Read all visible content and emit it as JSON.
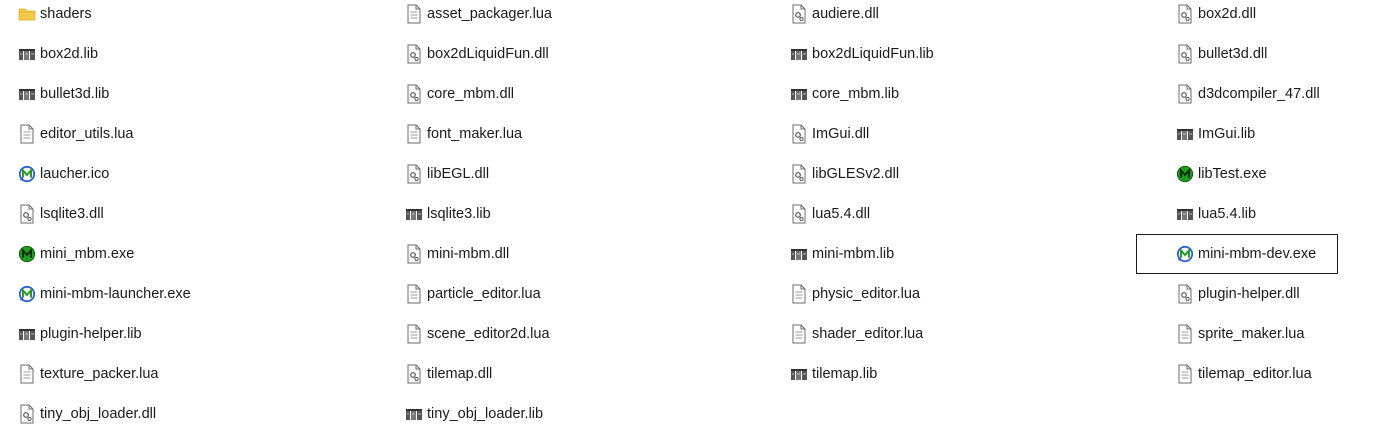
{
  "files": [
    {
      "name": "shaders",
      "icon": "folder-icon"
    },
    {
      "name": "asset_packager.lua",
      "icon": "text-file-icon"
    },
    {
      "name": "audiere.dll",
      "icon": "dll-file-icon"
    },
    {
      "name": "box2d.dll",
      "icon": "dll-file-icon"
    },
    {
      "name": "box2d.lib",
      "icon": "lib-file-icon"
    },
    {
      "name": "box2dLiquidFun.dll",
      "icon": "dll-file-icon"
    },
    {
      "name": "box2dLiquidFun.lib",
      "icon": "lib-file-icon"
    },
    {
      "name": "bullet3d.dll",
      "icon": "dll-file-icon"
    },
    {
      "name": "bullet3d.lib",
      "icon": "lib-file-icon"
    },
    {
      "name": "core_mbm.dll",
      "icon": "dll-file-icon"
    },
    {
      "name": "core_mbm.lib",
      "icon": "lib-file-icon"
    },
    {
      "name": "d3dcompiler_47.dll",
      "icon": "dll-file-icon"
    },
    {
      "name": "editor_utils.lua",
      "icon": "text-file-icon"
    },
    {
      "name": "font_maker.lua",
      "icon": "text-file-icon"
    },
    {
      "name": "ImGui.dll",
      "icon": "dll-file-icon"
    },
    {
      "name": "ImGui.lib",
      "icon": "lib-file-icon"
    },
    {
      "name": "laucher.ico",
      "icon": "mbm-logo-outline-icon"
    },
    {
      "name": "libEGL.dll",
      "icon": "dll-file-icon"
    },
    {
      "name": "libGLESv2.dll",
      "icon": "dll-file-icon"
    },
    {
      "name": "libTest.exe",
      "icon": "mbm-logo-filled-icon"
    },
    {
      "name": "lsqlite3.dll",
      "icon": "dll-file-icon"
    },
    {
      "name": "lsqlite3.lib",
      "icon": "lib-file-icon"
    },
    {
      "name": "lua5.4.dll",
      "icon": "dll-file-icon"
    },
    {
      "name": "lua5.4.lib",
      "icon": "lib-file-icon"
    },
    {
      "name": "mini_mbm.exe",
      "icon": "mbm-logo-filled-icon"
    },
    {
      "name": "mini-mbm.dll",
      "icon": "dll-file-icon"
    },
    {
      "name": "mini-mbm.lib",
      "icon": "lib-file-icon"
    },
    {
      "name": "mini-mbm-dev.exe",
      "icon": "mbm-logo-outline-icon",
      "focused": true
    },
    {
      "name": "mini-mbm-launcher.exe",
      "icon": "mbm-logo-outline-icon"
    },
    {
      "name": "particle_editor.lua",
      "icon": "text-file-icon"
    },
    {
      "name": "physic_editor.lua",
      "icon": "text-file-icon"
    },
    {
      "name": "plugin-helper.dll",
      "icon": "dll-file-icon"
    },
    {
      "name": "plugin-helper.lib",
      "icon": "lib-file-icon"
    },
    {
      "name": "scene_editor2d.lua",
      "icon": "text-file-icon"
    },
    {
      "name": "shader_editor.lua",
      "icon": "text-file-icon"
    },
    {
      "name": "sprite_maker.lua",
      "icon": "text-file-icon"
    },
    {
      "name": "texture_packer.lua",
      "icon": "text-file-icon"
    },
    {
      "name": "tilemap.dll",
      "icon": "dll-file-icon"
    },
    {
      "name": "tilemap.lib",
      "icon": "lib-file-icon"
    },
    {
      "name": "tilemap_editor.lua",
      "icon": "text-file-icon"
    },
    {
      "name": "tiny_obj_loader.dll",
      "icon": "dll-file-icon"
    },
    {
      "name": "tiny_obj_loader.lib",
      "icon": "lib-file-icon"
    }
  ],
  "colors": {
    "folder": "#f2c94c",
    "folder_dark": "#e0ae2a",
    "mbm_green": "#1f9d1f",
    "mbm_blue": "#2a5fd8",
    "file_border": "#6b6b6b"
  }
}
